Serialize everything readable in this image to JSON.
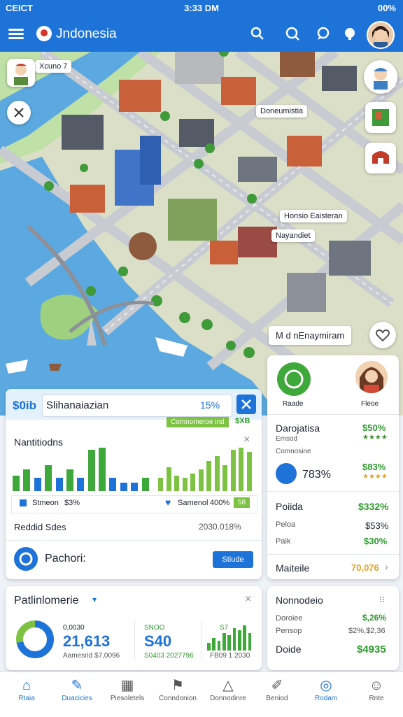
{
  "status": {
    "left": "CEICT",
    "time": "3:33 DM",
    "right": "00%"
  },
  "appbar": {
    "title": "Jndonesia"
  },
  "map": {
    "chips": {
      "top_left": "Xcuno 7",
      "station": "Doneumistia",
      "center": "Honsio Eaisteran",
      "nayard": "Nayandiet",
      "bottom": "M d nEnaymiram"
    }
  },
  "card_main": {
    "badge": "$0ib",
    "title": "Slihanaiazian",
    "pct": "15%",
    "subbadge": "Comnomeroe ind",
    "subval": "$XB",
    "section": "Nantitiodns",
    "bars_left": [
      0.35,
      0.5,
      0.3,
      0.6,
      0.3,
      0.5,
      0.3,
      0.95,
      1.0,
      0.3,
      0.2,
      0.2,
      0.3
    ],
    "bars_right": [
      0.3,
      0.55,
      0.35,
      0.3,
      0.4,
      0.5,
      0.7,
      0.8,
      0.6,
      0.95,
      1.0,
      0.9
    ],
    "legend_a": "Stmeon",
    "legend_a_val": "$3%",
    "legend_b": "Samenol",
    "legend_b_val": "400%",
    "legend_c": "58",
    "row_label": "Reddid Sdes",
    "row_val": "2030.018%",
    "promo": "Pachori:",
    "promo_button": "Stiude"
  },
  "card_side": {
    "label_a": "Raade",
    "label_b": "Fleoe",
    "r1_title": "Darojatisa",
    "r1_val": "$50%",
    "r1_sub": "Emsod",
    "r2_title": "Comnosine",
    "r2_val": "$83%",
    "big_pct": "783%",
    "r3_title": "Poiida",
    "r3_val": "$332%",
    "r4_title": "Peloa",
    "r4_val": "$53%",
    "r5_title": "Paik",
    "r5_val": "$30%",
    "foot_title": "Maiteile",
    "foot_val": "70,076"
  },
  "card_bottom_left": {
    "title": "Patlinlomerie",
    "k1_small": "0,0030",
    "k1_big": "21,613",
    "k1_foot": "Aamesrid $7,0096",
    "k2_small": "SNOO",
    "k2_big": "S40",
    "k2_foot": "S0403 2027796",
    "k3_small": "S7",
    "k3_foot": "FB09 1 2030",
    "donut": [
      0.72,
      0.28
    ]
  },
  "card_bottom_right": {
    "title": "Nonnodeio",
    "r1": "Doroiee",
    "r1_val": "$,26%",
    "r2": "Pensop",
    "r2_val": "$2%,$2,36",
    "r3": "Doide",
    "r3_val": "$4935"
  },
  "nav": [
    {
      "label": "Rtaia",
      "icon": "home-icon"
    },
    {
      "label": "Duacicies",
      "icon": "tools-icon"
    },
    {
      "label": "Piesoletels",
      "icon": "building-icon"
    },
    {
      "label": "Conndonion",
      "icon": "map-icon"
    },
    {
      "label": "Donnodinre",
      "icon": "tent-icon"
    },
    {
      "label": "Beniod",
      "icon": "edit-icon"
    },
    {
      "label": "Rodam",
      "icon": "search-icon"
    },
    {
      "label": "Rnte",
      "icon": "user-icon"
    }
  ],
  "colors": {
    "accent": "#1e73d8",
    "green": "#2e9a2e",
    "map_water": "#5ba9e0",
    "map_land": "#dcdfc8"
  }
}
